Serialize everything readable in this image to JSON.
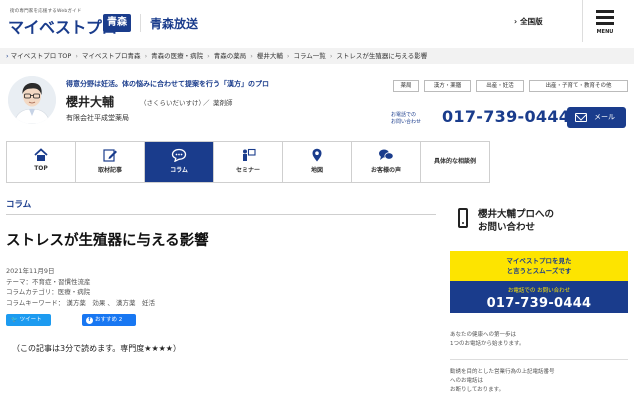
{
  "header": {
    "tagline": "街の専門家を応援するWebガイド",
    "logo": "マイベストプロ",
    "prefecture": "青森",
    "site_name": "青森放送",
    "nationwide": "全国版",
    "menu_label": "MENU"
  },
  "breadcrumb": [
    "マイベストプロ TOP",
    "マイベストプロ青森",
    "青森の医療・病院",
    "青森の薬局",
    "櫻井大輔",
    "コラム一覧",
    "ストレスが生殖器に与える影響"
  ],
  "profile": {
    "catch": "得意分野は妊活。体の悩みに合わせて提案を行う「漢方」のプロ",
    "name": "櫻井大輔",
    "kana": "（さくらいだいすけ）",
    "slash": "／",
    "role": "薬剤師",
    "company": "有限会社平成堂薬局",
    "tags": [
      "薬局",
      "漢方・薬膳",
      "出産・妊活",
      "出産・子育て・教育その他"
    ],
    "tel_note": "お電話での\nお問い合わせ",
    "tel": "017-739-0444",
    "mail_label": "メール"
  },
  "tabs": [
    {
      "label": "TOP",
      "icon": "home-icon"
    },
    {
      "label": "取材記事",
      "icon": "pencil-icon"
    },
    {
      "label": "コラム",
      "icon": "chat-icon"
    },
    {
      "label": "セミナー",
      "icon": "seminar-icon"
    },
    {
      "label": "地図",
      "icon": "map-pin-icon"
    },
    {
      "label": "お客様の声",
      "icon": "voices-icon"
    },
    {
      "label": "具体的な相談例",
      "icon": ""
    }
  ],
  "article": {
    "section": "コラム",
    "title": "ストレスが生殖器に与える影響",
    "date": "2021年11月9日",
    "theme": "テーマ：不育症・習慣性流産",
    "category": "コラムカテゴリ：医療・病院",
    "keywords": "コラムキーワード： 漢方薬　効果 、 漢方薬　妊活",
    "tweet_label": "ツイート",
    "fb_label": "おすすめ 2",
    "read_note": "（この記事は3分で読めます。専門度★★★★）"
  },
  "side": {
    "contact_title": "櫻井大輔プロへの\nお問い合わせ",
    "yellow_text": "マイベストプロを見た\nと言うとスムーズです",
    "tel_label": "お電話での お問い合わせ",
    "tel": "017-739-0444",
    "note": "あなたの健康への第一歩は\n1つのお電話から始まります。",
    "note2": "勧誘を目的とした営業行為の上記電話番号\nへのお電話は\nお断りしております。"
  },
  "colors": {
    "brand": "#1a3c8c",
    "accent": "#fde400",
    "twitter": "#1d9bf0",
    "facebook": "#1877f2"
  }
}
